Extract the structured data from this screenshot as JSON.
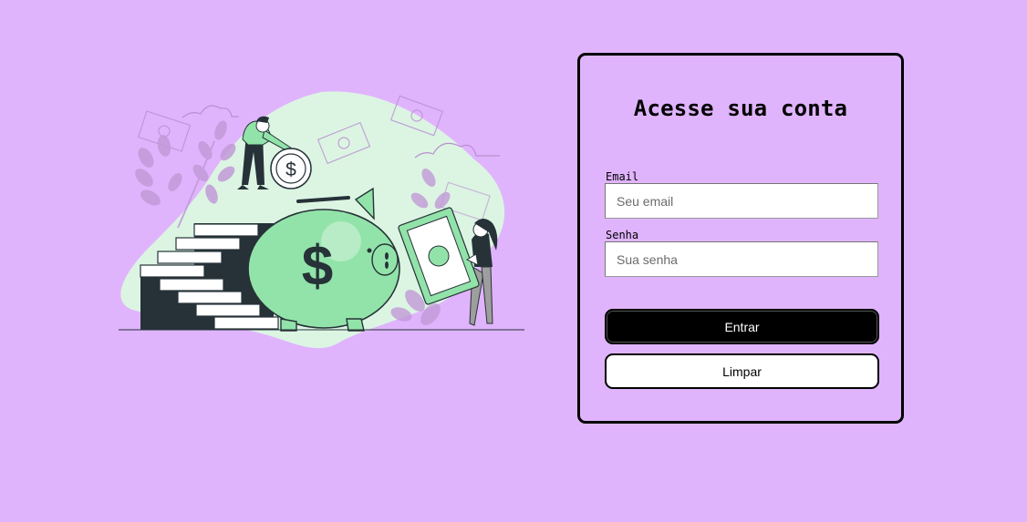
{
  "illustration": {
    "name": "piggy-bank-savings-illustration",
    "colors": {
      "accent_green": "#92e3a9",
      "blob_green": "#dcf5e3",
      "dark": "#263238"
    }
  },
  "login": {
    "title": "Acesse sua conta",
    "email": {
      "label": "Email",
      "value": "",
      "placeholder": "Seu email"
    },
    "password": {
      "label": "Senha",
      "value": "",
      "placeholder": "Sua senha"
    },
    "submit_label": "Entrar",
    "clear_label": "Limpar"
  },
  "colors": {
    "background": "#e0b4fc",
    "primary_button": "#000000",
    "secondary_button": "#ffffff"
  }
}
